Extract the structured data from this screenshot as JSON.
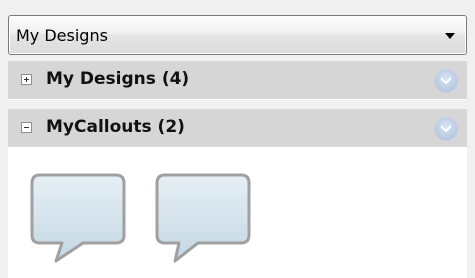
{
  "dropdown": {
    "selected": "My Designs"
  },
  "groups": [
    {
      "title": "My Designs (4)",
      "expanded": false,
      "expander_icon": "plus-box-icon",
      "chevron_icon": "chevron-down-circle-icon"
    },
    {
      "title": "MyCallouts (2)",
      "expanded": true,
      "expander_icon": "minus-box-icon",
      "chevron_icon": "chevron-down-circle-icon"
    }
  ],
  "callouts": [
    {
      "icon": "speech-bubble-callout-icon"
    },
    {
      "icon": "speech-bubble-callout-icon"
    }
  ],
  "colors": {
    "header_bg": "#d6d6d6",
    "content_bg": "#ffffff",
    "panel_bg": "#f0f0f0",
    "chevron_blue": "#a9bfdb",
    "callout_fill": "#d4e2ea",
    "callout_border": "#a0a0a0"
  }
}
